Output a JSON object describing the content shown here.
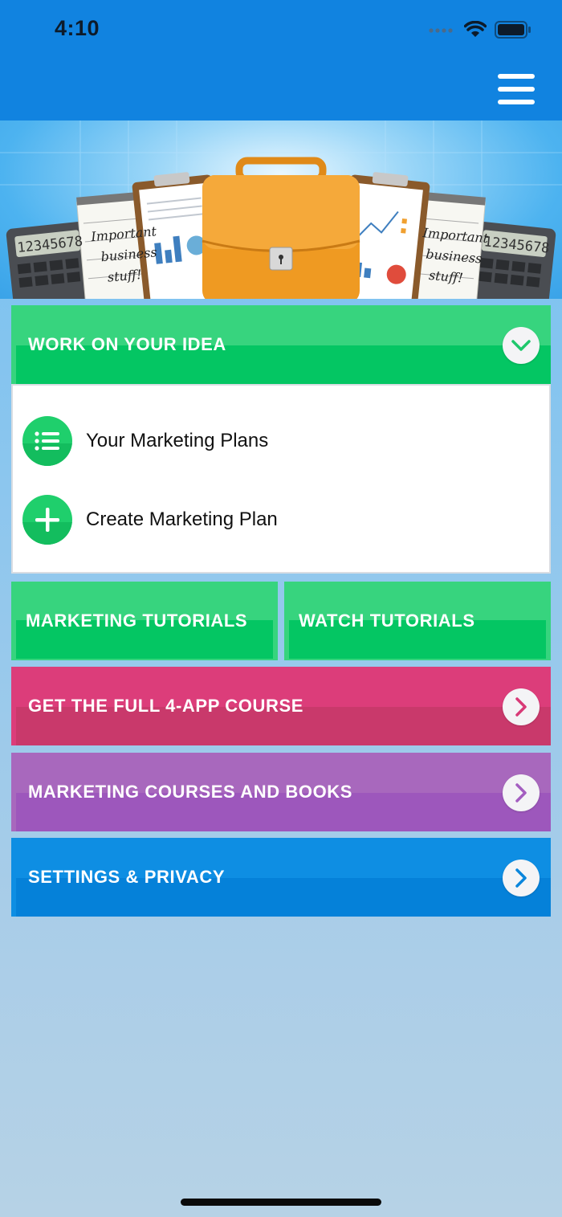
{
  "status_bar": {
    "time": "4:10"
  },
  "icons": {
    "menu": "hamburger-menu-icon",
    "chevron_down": "chevron-down-icon",
    "chevron_right": "chevron-right-icon",
    "list": "list-icon",
    "plus": "plus-icon",
    "signal": "cellular-signal-icon",
    "wifi": "wifi-icon",
    "battery": "battery-icon"
  },
  "hero": {
    "note_text_lines": [
      "Important",
      "business",
      "stuff!"
    ],
    "calculator_display": "12345678"
  },
  "work_on_idea": {
    "title": "WORK ON YOUR IDEA",
    "items": [
      {
        "label": "Your Marketing Plans"
      },
      {
        "label": "Create Marketing Plan"
      }
    ]
  },
  "tutorials": {
    "marketing_tutorials": "MARKETING TUTORIALS",
    "watch_tutorials": "WATCH TUTORIALS"
  },
  "menu_cards": [
    {
      "label": "GET THE FULL 4-APP COURSE",
      "accent": "#dc3d7a"
    },
    {
      "label": "MARKETING COURSES AND BOOKS",
      "accent": "#a868bd"
    },
    {
      "label": "SETTINGS & PRIVACY",
      "accent": "#0e8ee3"
    }
  ],
  "colors": {
    "nav": "#1183e0",
    "green": "#37d47e",
    "pink": "#dc3d7a",
    "purple": "#a868bd",
    "blue": "#0e8ee3"
  }
}
